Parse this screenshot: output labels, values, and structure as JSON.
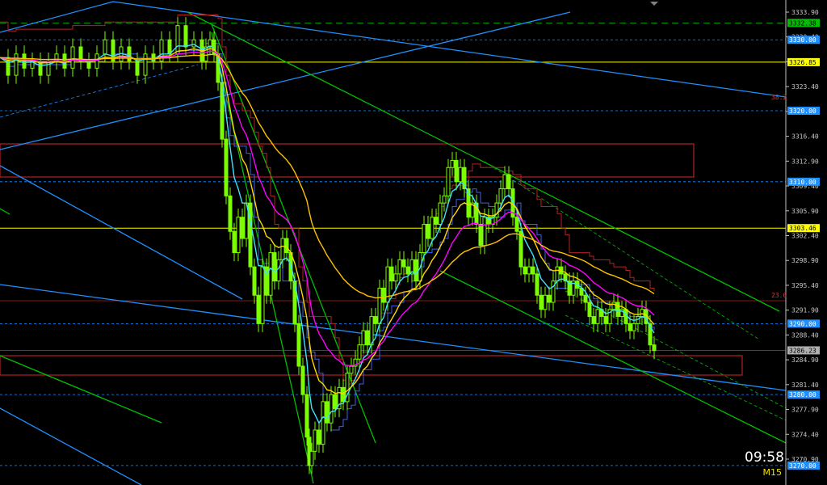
{
  "chart_data": {
    "type": "candlestick",
    "timeframe": "M15",
    "clock": "09:58",
    "y_ticks": [
      "3333.90",
      "3330.40",
      "3326.90",
      "3323.40",
      "3319.90",
      "3316.40",
      "3312.90",
      "3309.40",
      "3305.90",
      "3302.40",
      "3298.90",
      "3295.40",
      "3291.90",
      "3288.40",
      "3284.90",
      "3281.40",
      "3277.90",
      "3274.40",
      "3270.90"
    ],
    "ylim": [
      3269.5,
      3336.0
    ],
    "price_badges": [
      {
        "label": "3332.38",
        "value": 3332.38,
        "color": "#00c000"
      },
      {
        "label": "3330.00",
        "value": 3330.0,
        "color": "#1e90ff"
      },
      {
        "label": "3326.85",
        "value": 3326.85,
        "color": "#ffff00"
      },
      {
        "label": "3320.00",
        "value": 3320.0,
        "color": "#1e90ff"
      },
      {
        "label": "3310.00",
        "value": 3310.0,
        "color": "#1e90ff"
      },
      {
        "label": "3303.46",
        "value": 3303.46,
        "color": "#ffff00"
      },
      {
        "label": "3290.00",
        "value": 3290.0,
        "color": "#1e90ff"
      },
      {
        "label": "3286.23",
        "value": 3286.23,
        "color": "#a0a0a0"
      },
      {
        "label": "3280.00",
        "value": 3280.0,
        "color": "#1e90ff"
      },
      {
        "label": "3270.00",
        "value": 3270.0,
        "color": "#1e90ff"
      }
    ],
    "fib_labels": [
      {
        "label": "38.2",
        "value": 3320.8
      },
      {
        "label": "23.6",
        "value": 3293.6
      }
    ],
    "close_path": [
      [
        0,
        3327.5
      ],
      [
        10,
        3325
      ],
      [
        20,
        3328
      ],
      [
        30,
        3326
      ],
      [
        40,
        3327
      ],
      [
        50,
        3325
      ],
      [
        60,
        3327
      ],
      [
        70,
        3328
      ],
      [
        80,
        3326
      ],
      [
        90,
        3329
      ],
      [
        100,
        3327
      ],
      [
        110,
        3326
      ],
      [
        120,
        3328
      ],
      [
        130,
        3330
      ],
      [
        140,
        3327
      ],
      [
        150,
        3329
      ],
      [
        160,
        3327
      ],
      [
        170,
        3325
      ],
      [
        180,
        3328
      ],
      [
        190,
        3327
      ],
      [
        200,
        3330
      ],
      [
        210,
        3328
      ],
      [
        220,
        3332
      ],
      [
        230,
        3329
      ],
      [
        240,
        3330
      ],
      [
        250,
        3327
      ],
      [
        255,
        3329
      ],
      [
        260,
        3330
      ],
      [
        265,
        3328
      ],
      [
        270,
        3324
      ],
      [
        275,
        3316
      ],
      [
        280,
        3308
      ],
      [
        285,
        3303
      ],
      [
        290,
        3300
      ],
      [
        295,
        3305
      ],
      [
        300,
        3302
      ],
      [
        305,
        3307
      ],
      [
        310,
        3298
      ],
      [
        315,
        3294
      ],
      [
        320,
        3290
      ],
      [
        325,
        3298
      ],
      [
        330,
        3294
      ],
      [
        335,
        3300
      ],
      [
        340,
        3296
      ],
      [
        345,
        3299
      ],
      [
        350,
        3302
      ],
      [
        355,
        3300
      ],
      [
        360,
        3296
      ],
      [
        365,
        3290
      ],
      [
        370,
        3284
      ],
      [
        375,
        3280
      ],
      [
        380,
        3274
      ],
      [
        383,
        3270
      ],
      [
        386,
        3272
      ],
      [
        390,
        3275
      ],
      [
        395,
        3273
      ],
      [
        400,
        3279
      ],
      [
        405,
        3276
      ],
      [
        410,
        3280
      ],
      [
        415,
        3278
      ],
      [
        420,
        3281
      ],
      [
        425,
        3279
      ],
      [
        430,
        3283
      ],
      [
        435,
        3284
      ],
      [
        440,
        3285
      ],
      [
        445,
        3287
      ],
      [
        450,
        3289
      ],
      [
        455,
        3287
      ],
      [
        460,
        3291
      ],
      [
        465,
        3290
      ],
      [
        470,
        3295
      ],
      [
        475,
        3293
      ],
      [
        480,
        3298
      ],
      [
        485,
        3296
      ],
      [
        490,
        3297
      ],
      [
        495,
        3299
      ],
      [
        500,
        3298
      ],
      [
        505,
        3297
      ],
      [
        510,
        3299
      ],
      [
        515,
        3296
      ],
      [
        520,
        3300
      ],
      [
        525,
        3304
      ],
      [
        530,
        3302
      ],
      [
        535,
        3305
      ],
      [
        540,
        3304
      ],
      [
        545,
        3307
      ],
      [
        550,
        3308
      ],
      [
        555,
        3312
      ],
      [
        560,
        3313
      ],
      [
        565,
        3310
      ],
      [
        570,
        3312
      ],
      [
        575,
        3309
      ],
      [
        580,
        3305
      ],
      [
        585,
        3307
      ],
      [
        590,
        3304
      ],
      [
        595,
        3301
      ],
      [
        600,
        3305
      ],
      [
        605,
        3304
      ],
      [
        610,
        3305
      ],
      [
        615,
        3307
      ],
      [
        620,
        3309
      ],
      [
        625,
        3311
      ],
      [
        630,
        3309
      ],
      [
        635,
        3305
      ],
      [
        640,
        3303
      ],
      [
        645,
        3298
      ],
      [
        650,
        3297
      ],
      [
        655,
        3298
      ],
      [
        660,
        3297
      ],
      [
        665,
        3294
      ],
      [
        670,
        3292
      ],
      [
        675,
        3294
      ],
      [
        680,
        3293
      ],
      [
        685,
        3296
      ],
      [
        690,
        3298
      ],
      [
        695,
        3297
      ],
      [
        700,
        3296
      ],
      [
        705,
        3294
      ],
      [
        710,
        3296
      ],
      [
        715,
        3295
      ],
      [
        720,
        3294
      ],
      [
        725,
        3293
      ],
      [
        730,
        3291
      ],
      [
        735,
        3290
      ],
      [
        740,
        3292
      ],
      [
        745,
        3291
      ],
      [
        750,
        3290
      ],
      [
        755,
        3292
      ],
      [
        760,
        3293
      ],
      [
        765,
        3291
      ],
      [
        770,
        3292
      ],
      [
        775,
        3290
      ],
      [
        780,
        3289
      ],
      [
        785,
        3290
      ],
      [
        790,
        3291
      ],
      [
        795,
        3292
      ],
      [
        800,
        3290
      ],
      [
        805,
        3287
      ],
      [
        810,
        3286.2
      ]
    ]
  }
}
